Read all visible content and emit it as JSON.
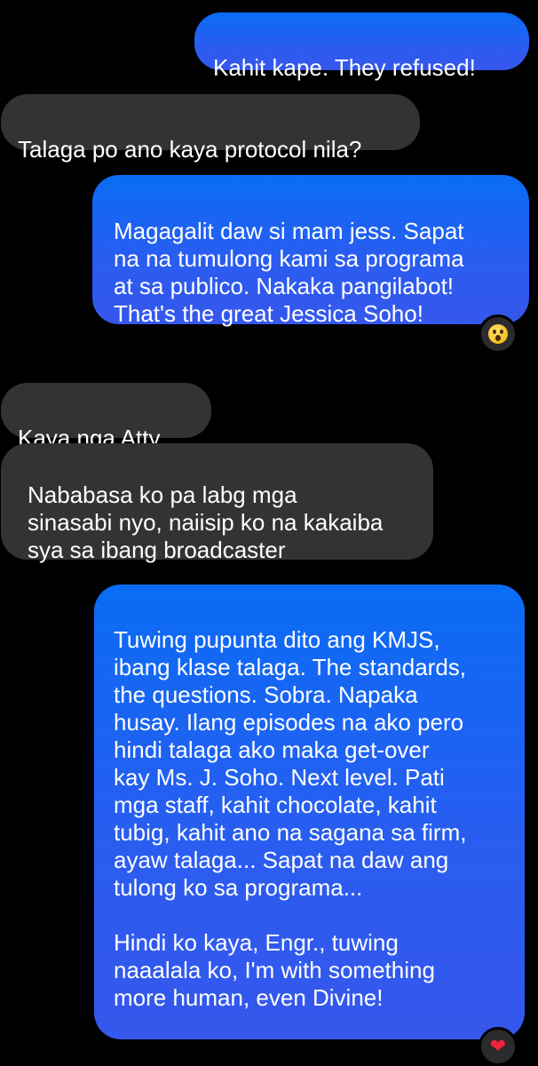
{
  "messages": [
    {
      "id": "m1",
      "direction": "outgoing",
      "text": "Kahit kape. They refused!"
    },
    {
      "id": "m2",
      "direction": "incoming",
      "text": "Talaga po ano kaya protocol nila?"
    },
    {
      "id": "m3",
      "direction": "outgoing",
      "text": "Magagalit daw si mam jess. Sapat\nna na tumulong kami sa programa\nat sa publico. Nakaka pangilabot!\nThat's the great Jessica Soho!",
      "reaction": "wow"
    },
    {
      "id": "m4",
      "direction": "incoming",
      "text": "Kaya nga Atty.,"
    },
    {
      "id": "m5",
      "direction": "incoming",
      "text": "Nababasa ko pa labg mga\nsinasabi nyo, naiisip ko na kakaiba\nsya sa ibang broadcaster"
    },
    {
      "id": "m6",
      "direction": "outgoing",
      "text": "Tuwing pupunta dito ang KMJS,\nibang klase talaga. The standards,\nthe questions. Sobra. Napaka\nhusay. Ilang episodes na ako pero\nhindi talaga ako maka get-over\nkay Ms. J. Soho. Next level. Pati\nmga staff, kahit chocolate, kahit\ntubig, kahit ano na sagana sa firm,\nayaw talaga... Sapat na daw ang\ntulong ko sa programa...\n\nHindi ko kaya, Engr., tuwing\nnaaalala ko, I'm with something\nmore human, even Divine!",
      "reaction": "heart"
    }
  ],
  "colors": {
    "background": "#000000",
    "outgoing_bubble": "#2b5cf0",
    "incoming_bubble": "#333335",
    "text": "#ffffff",
    "heart": "#f0233b"
  },
  "icons": {
    "wow_reaction": "wow-face-icon",
    "heart_reaction": "heart-icon"
  }
}
